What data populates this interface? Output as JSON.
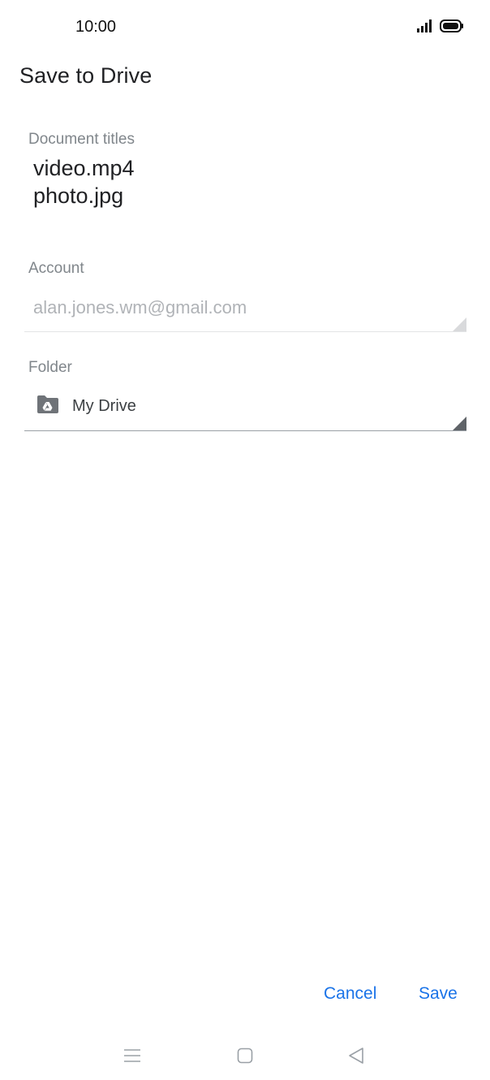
{
  "status_bar": {
    "time": "10:00",
    "icons": [
      "signal-icon",
      "battery-icon"
    ]
  },
  "header": {
    "title": "Save to Drive"
  },
  "document_titles": {
    "label": "Document titles",
    "items": [
      "video.mp4",
      "photo.jpg"
    ]
  },
  "account": {
    "label": "Account",
    "value": "alan.jones.wm@gmail.com"
  },
  "folder": {
    "label": "Folder",
    "value": "My Drive",
    "icon": "drive-folder-icon"
  },
  "actions": {
    "cancel_label": "Cancel",
    "save_label": "Save"
  },
  "nav_bar": {
    "icons": [
      "menu-icon",
      "home-icon",
      "back-icon"
    ]
  },
  "colors": {
    "accent": "#1a73e8",
    "label": "#80868b",
    "disabled_text": "#b0b3b7"
  }
}
